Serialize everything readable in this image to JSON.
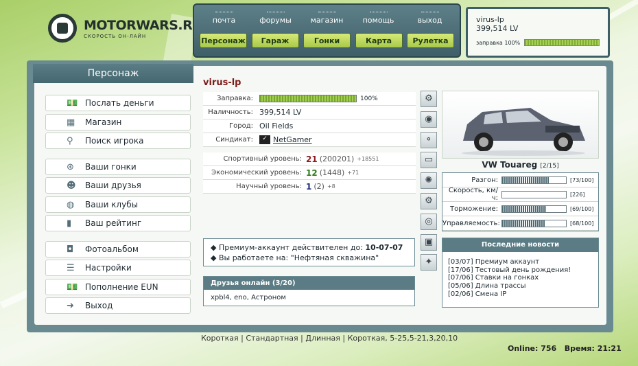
{
  "brand": {
    "name": "MOTORWARS.RU",
    "tagline": "СКОРОСТЬ ОН-ЛАЙН"
  },
  "topnav": {
    "links": [
      "почта",
      "форумы",
      "магазин",
      "помощь",
      "выход"
    ],
    "buttons": [
      "Персонаж",
      "Гараж",
      "Гонки",
      "Карта",
      "Рулетка"
    ]
  },
  "userbox": {
    "name": "virus-lp",
    "money": "399,514 LV",
    "fuel_label": "заправка 100%",
    "fuel_level": 1.0
  },
  "sidebar": {
    "title": "Персонаж",
    "groups": [
      [
        {
          "label": "Послать деньги",
          "icon": "money-icon"
        },
        {
          "label": "Магазин",
          "icon": "shop-icon"
        },
        {
          "label": "Поиск игрока",
          "icon": "magnifier-icon"
        }
      ],
      [
        {
          "label": "Ваши гонки",
          "icon": "steering-wheel-icon"
        },
        {
          "label": "Ваши друзья",
          "icon": "friends-icon"
        },
        {
          "label": "Ваши клубы",
          "icon": "globe-icon"
        },
        {
          "label": "Ваш рейтинг",
          "icon": "bar-chart-icon"
        }
      ],
      [
        {
          "label": "Фотоальбом",
          "icon": "camera-icon"
        },
        {
          "label": "Настройки",
          "icon": "sliders-icon"
        },
        {
          "label": "Пополнение EUN",
          "icon": "money-icon"
        },
        {
          "label": "Выход",
          "icon": "exit-icon"
        }
      ]
    ]
  },
  "profile": {
    "nick": "virus-lp",
    "fuel_label": "Заправка:",
    "fuel_percent": "100%",
    "fuel_level": 1.0,
    "cash_label": "Наличность:",
    "cash": "399,514 LV",
    "city_label": "Город:",
    "city": "Oil Fields",
    "syndicate_label": "Синдикат:",
    "syndicate": "NetGamer",
    "levels": [
      {
        "label": "Спортивный уровень:",
        "value": "21",
        "points": "(200201)",
        "delta": "+18551",
        "color": "#8b1a1a"
      },
      {
        "label": "Экономический уровень:",
        "value": "12",
        "points": "(1448)",
        "delta": "+71",
        "color": "#2e7d1e"
      },
      {
        "label": "Научный уровень:",
        "value": "1",
        "points": "(2)",
        "delta": "+8",
        "color": "#1d2f7a"
      }
    ]
  },
  "premium": {
    "line1": "Премиум-аккаунт действителен до:",
    "date": "10-07-07",
    "line2": "Вы работаете на: \"Нефтяная скважина\""
  },
  "friends": {
    "title": "Друзья онлайн (3/20)",
    "list": "xpbl4, eno, Астроном"
  },
  "car": {
    "name": "VW Touareg",
    "slot": "[2/15]",
    "stats": [
      {
        "label": "Разгон:",
        "value": "[73/100]",
        "level": 0.73
      },
      {
        "label": "Скорость, км/ч:",
        "value": "[226]",
        "level": 0.0
      },
      {
        "label": "Торможение:",
        "value": "[69/100]",
        "level": 0.69
      },
      {
        "label": "Управляемость:",
        "value": "[68/100]",
        "level": 0.68
      }
    ]
  },
  "news": {
    "title": "Последние новости",
    "items": [
      "[03/07] Премиум аккаунт",
      "[17/06] Тестовый день рождения!",
      "[07/06] Ставки на гонках",
      "[05/06] Длина трассы",
      "[02/06] Смена IP"
    ]
  },
  "footer": {
    "links": "Короткая | Стандартная | Длинная | Короткая, 5-25,5-21,3,20,10",
    "online": "Online: 756",
    "time": "Время: 21:21"
  }
}
